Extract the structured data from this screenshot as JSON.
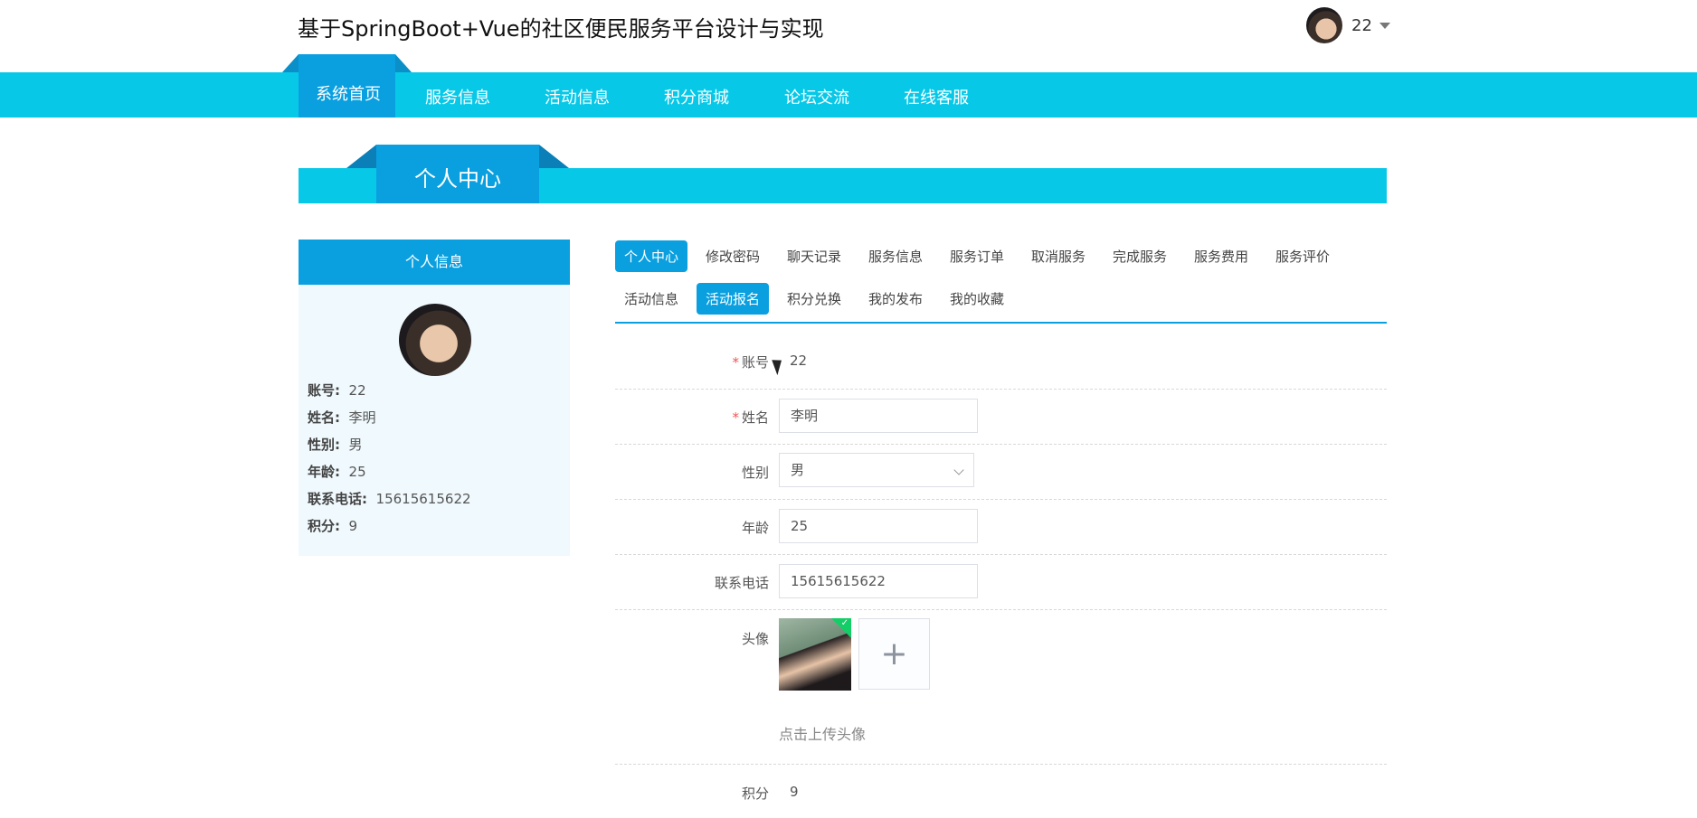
{
  "header": {
    "title": "基于SpringBoot+Vue的社区便民服务平台设计与实现",
    "user": "22"
  },
  "nav": {
    "items": [
      "系统首页",
      "服务信息",
      "活动信息",
      "积分商城",
      "论坛交流",
      "在线客服"
    ],
    "active": "系统首页"
  },
  "section": {
    "title": "个人中心"
  },
  "sidebar": {
    "title": "个人信息",
    "rows": [
      {
        "label": "账号:",
        "value": "22"
      },
      {
        "label": "姓名:",
        "value": "李明"
      },
      {
        "label": "性别:",
        "value": "男"
      },
      {
        "label": "年龄:",
        "value": "25"
      },
      {
        "label": "联系电话:",
        "value": "15615615622"
      },
      {
        "label": "积分:",
        "value": "9"
      }
    ]
  },
  "tabs": {
    "row1": [
      "个人中心",
      "修改密码",
      "聊天记录",
      "服务信息",
      "服务订单",
      "取消服务",
      "完成服务",
      "服务费用",
      "服务评价"
    ],
    "row2": [
      "活动信息",
      "活动报名",
      "积分兑换",
      "我的发布",
      "我的收藏"
    ],
    "active": [
      "个人中心",
      "活动报名"
    ]
  },
  "form": {
    "account_label": "账号",
    "account_value": "22",
    "name_label": "姓名",
    "name_value": "李明",
    "gender_label": "性别",
    "gender_value": "男",
    "age_label": "年龄",
    "age_value": "25",
    "phone_label": "联系电话",
    "phone_value": "15615615622",
    "avatar_label": "头像",
    "upload_tip": "点击上传头像",
    "points_label": "积分",
    "points_value": "9"
  },
  "colors": {
    "primary": "#0aa0e0",
    "nav_bg": "#08c8e8",
    "success": "#13ce66"
  }
}
